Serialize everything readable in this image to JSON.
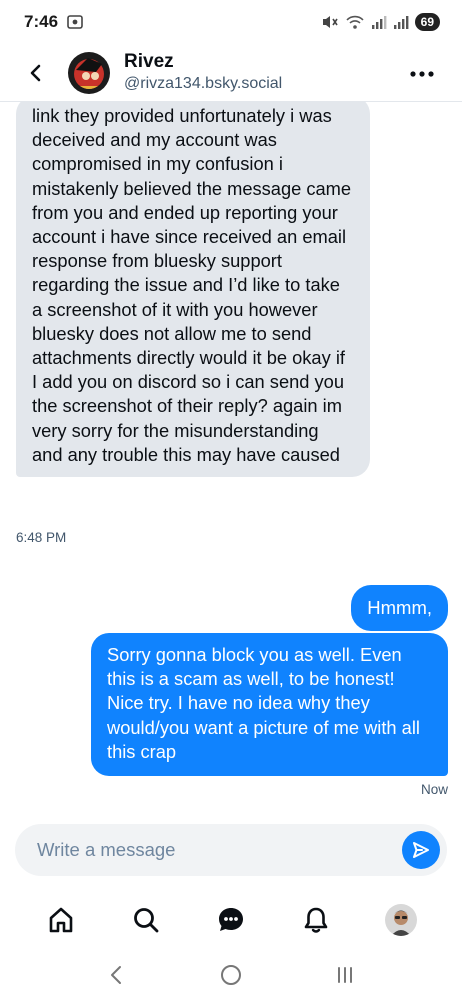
{
  "status_bar": {
    "time": "7:46",
    "battery": "69"
  },
  "header": {
    "name": "Rivez",
    "handle": "@rivza134.bsky.social"
  },
  "messages": {
    "incoming": {
      "text": "link they provided unfortunately i was deceived and my account was compromised in my confusion i mistakenly believed the message came from you and ended up reporting your account i have since received an email response from bluesky support regarding the issue and I’d like to take a screenshot of it with you however bluesky does not allow me to send attachments directly would it be okay if I add you on discord so i can send you the screenshot of their reply? again im very sorry for the misunderstanding and any trouble this may have caused",
      "timestamp": "6:48 PM"
    },
    "outgoing": [
      {
        "text": "Hmmm,"
      },
      {
        "text": "Sorry gonna block you as well. Even this is a scam as well, to be honest! Nice try. I have no idea why they would/you want a picture of me with all this crap"
      }
    ],
    "outgoing_timestamp": "Now"
  },
  "composer": {
    "placeholder": "Write a message",
    "value": ""
  },
  "bottom_nav": {
    "items": [
      "home-icon",
      "search-icon",
      "chat-icon",
      "bell-icon",
      "profile-avatar"
    ]
  },
  "colors": {
    "accent": "#1083fe",
    "incoming_bubble": "#e3e7ec",
    "muted_text": "#42576c"
  }
}
